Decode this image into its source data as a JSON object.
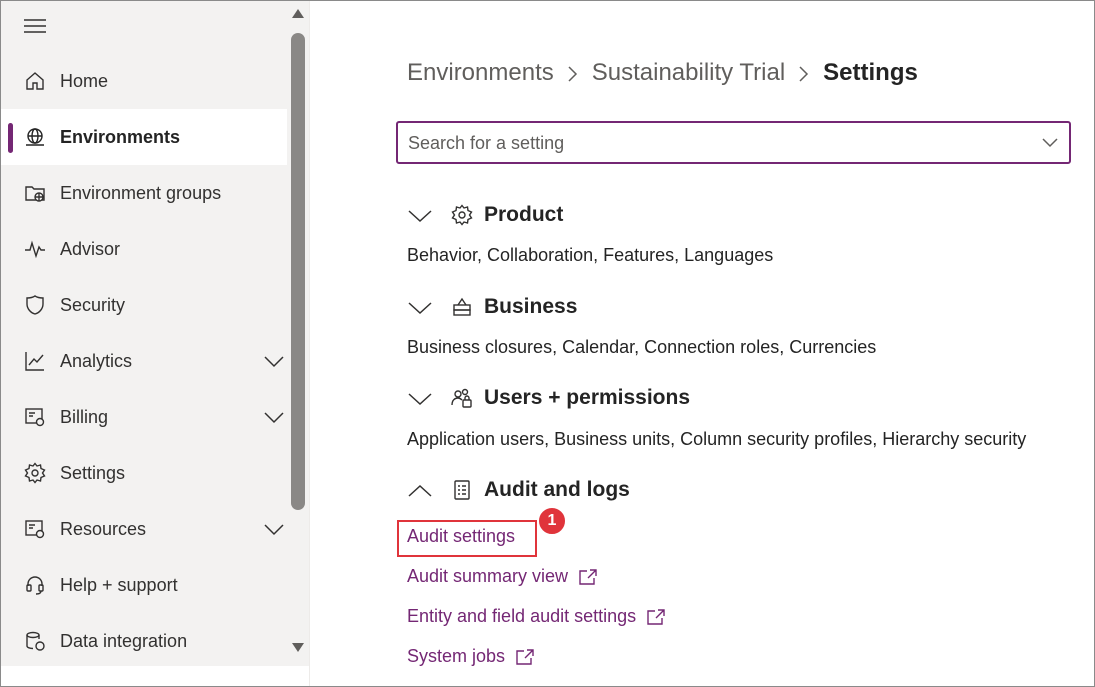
{
  "sidebar": {
    "menu_icon": "hamburger-icon",
    "items": [
      {
        "label": "Home",
        "icon": "home-icon",
        "expandable": false
      },
      {
        "label": "Environments",
        "icon": "globe-icon",
        "expandable": false,
        "selected": true
      },
      {
        "label": "Environment groups",
        "icon": "folder-globe-icon",
        "expandable": false
      },
      {
        "label": "Advisor",
        "icon": "pulse-icon",
        "expandable": false
      },
      {
        "label": "Security",
        "icon": "shield-icon",
        "expandable": false
      },
      {
        "label": "Analytics",
        "icon": "chart-line-icon",
        "expandable": true
      },
      {
        "label": "Billing",
        "icon": "billing-icon",
        "expandable": true
      },
      {
        "label": "Settings",
        "icon": "gear-icon",
        "expandable": false
      },
      {
        "label": "Resources",
        "icon": "resources-icon",
        "expandable": true
      },
      {
        "label": "Help + support",
        "icon": "headset-icon",
        "expandable": false
      },
      {
        "label": "Data integration",
        "icon": "database-icon",
        "expandable": false
      }
    ]
  },
  "breadcrumb": {
    "items": [
      "Environments",
      "Sustainability Trial"
    ],
    "current": "Settings"
  },
  "search": {
    "placeholder": "Search for a setting",
    "value": ""
  },
  "sections": [
    {
      "title": "Product",
      "icon": "gear-icon",
      "expanded": false,
      "description": "Behavior, Collaboration, Features, Languages"
    },
    {
      "title": "Business",
      "icon": "business-icon",
      "expanded": false,
      "description": "Business closures, Calendar, Connection roles, Currencies"
    },
    {
      "title": "Users + permissions",
      "icon": "users-lock-icon",
      "expanded": false,
      "description": "Application users, Business units, Column security profiles, Hierarchy security"
    },
    {
      "title": "Audit and logs",
      "icon": "checklist-icon",
      "expanded": true,
      "links": [
        {
          "label": "Audit settings",
          "external": false
        },
        {
          "label": "Audit summary view",
          "external": true
        },
        {
          "label": "Entity and field audit settings",
          "external": true
        },
        {
          "label": "System jobs",
          "external": true
        }
      ]
    }
  ],
  "annotation": {
    "badge": "1"
  },
  "colors": {
    "accent": "#742774",
    "highlight": "#e0343b",
    "sidebar_bg": "#f3f2f1"
  }
}
